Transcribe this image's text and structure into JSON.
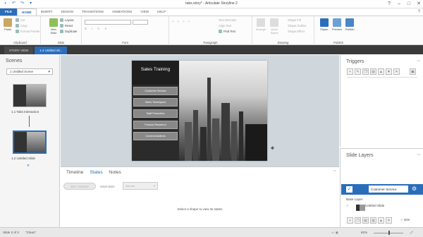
{
  "title": "tabs.story* - Articulate Storyline 2",
  "ribbon_tabs": [
    "FILE",
    "HOME",
    "INSERT",
    "DESIGN",
    "TRANSITIONS",
    "ANIMATIONS",
    "VIEW",
    "HELP"
  ],
  "ribbon": {
    "clipboard": {
      "label": "Clipboard",
      "paste": "Paste",
      "cut": "Cut",
      "copy": "Copy",
      "format_painter": "Format Painter"
    },
    "slide": {
      "label": "Slide",
      "new_slide": "New Slide",
      "layout": "Layout",
      "reset": "Reset",
      "duplicate": "Duplicate"
    },
    "font": {
      "label": "Font"
    },
    "paragraph": {
      "label": "Paragraph",
      "text_direction": "Text Direction",
      "align_text": "Align Text",
      "find_text": "Find Text"
    },
    "drawing": {
      "label": "Drawing",
      "arrange": "Arrange",
      "quick_styles": "Quick Styles",
      "shape_fill": "Shape Fill",
      "shape_outline": "Shape Outline",
      "shape_effect": "Shape Effect"
    },
    "publish": {
      "label": "Publish",
      "player": "Player",
      "preview": "Preview",
      "publish": "Publish"
    }
  },
  "view_tabs": [
    "STORY VIEW",
    "1.2 Untitled Sli..."
  ],
  "scenes": {
    "header": "Scenes",
    "selected_scene": "1 Untitled Scene",
    "slides": [
      {
        "label": "1.1 Tabs Interaction"
      },
      {
        "label": "1.2 Untitled Slide"
      }
    ]
  },
  "slide": {
    "title": "Sales Training",
    "buttons": [
      "Customer Service",
      "Sales Techniques",
      "Staff Promotion",
      "Product Research",
      "Communications"
    ]
  },
  "bottom": {
    "tabs": [
      "Timeline",
      "States",
      "Notes"
    ],
    "edit_states": "EDIT STATES",
    "initial_state_label": "Initial state:",
    "initial_state_value": "Normal",
    "empty_message": "Select a shape to view its states"
  },
  "triggers": {
    "header": "Triggers"
  },
  "layers": {
    "header": "Slide Layers",
    "layer_name": "Customer Service",
    "base_layer_label": "Base Layer",
    "base_slide": "Untitled Slide",
    "dim_label": "Dim"
  },
  "status": {
    "slide": "Slide 2 of 2",
    "theme": "\"Clean\"",
    "zoom": "62%"
  },
  "colors": {
    "accent": "#2a6ebb",
    "dark": "#3a3a3a"
  }
}
